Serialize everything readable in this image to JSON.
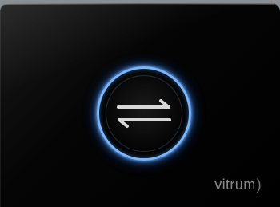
{
  "brand": {
    "name": "vitrum",
    "paren": ")"
  },
  "control": {
    "icon": "swap-arrows-icon",
    "ring_color": "#79b6ff",
    "glow_color": "#2f7dff"
  },
  "colors": {
    "panel": "#000000",
    "frame": "#6e7378",
    "icon": "#d7d7d7"
  }
}
